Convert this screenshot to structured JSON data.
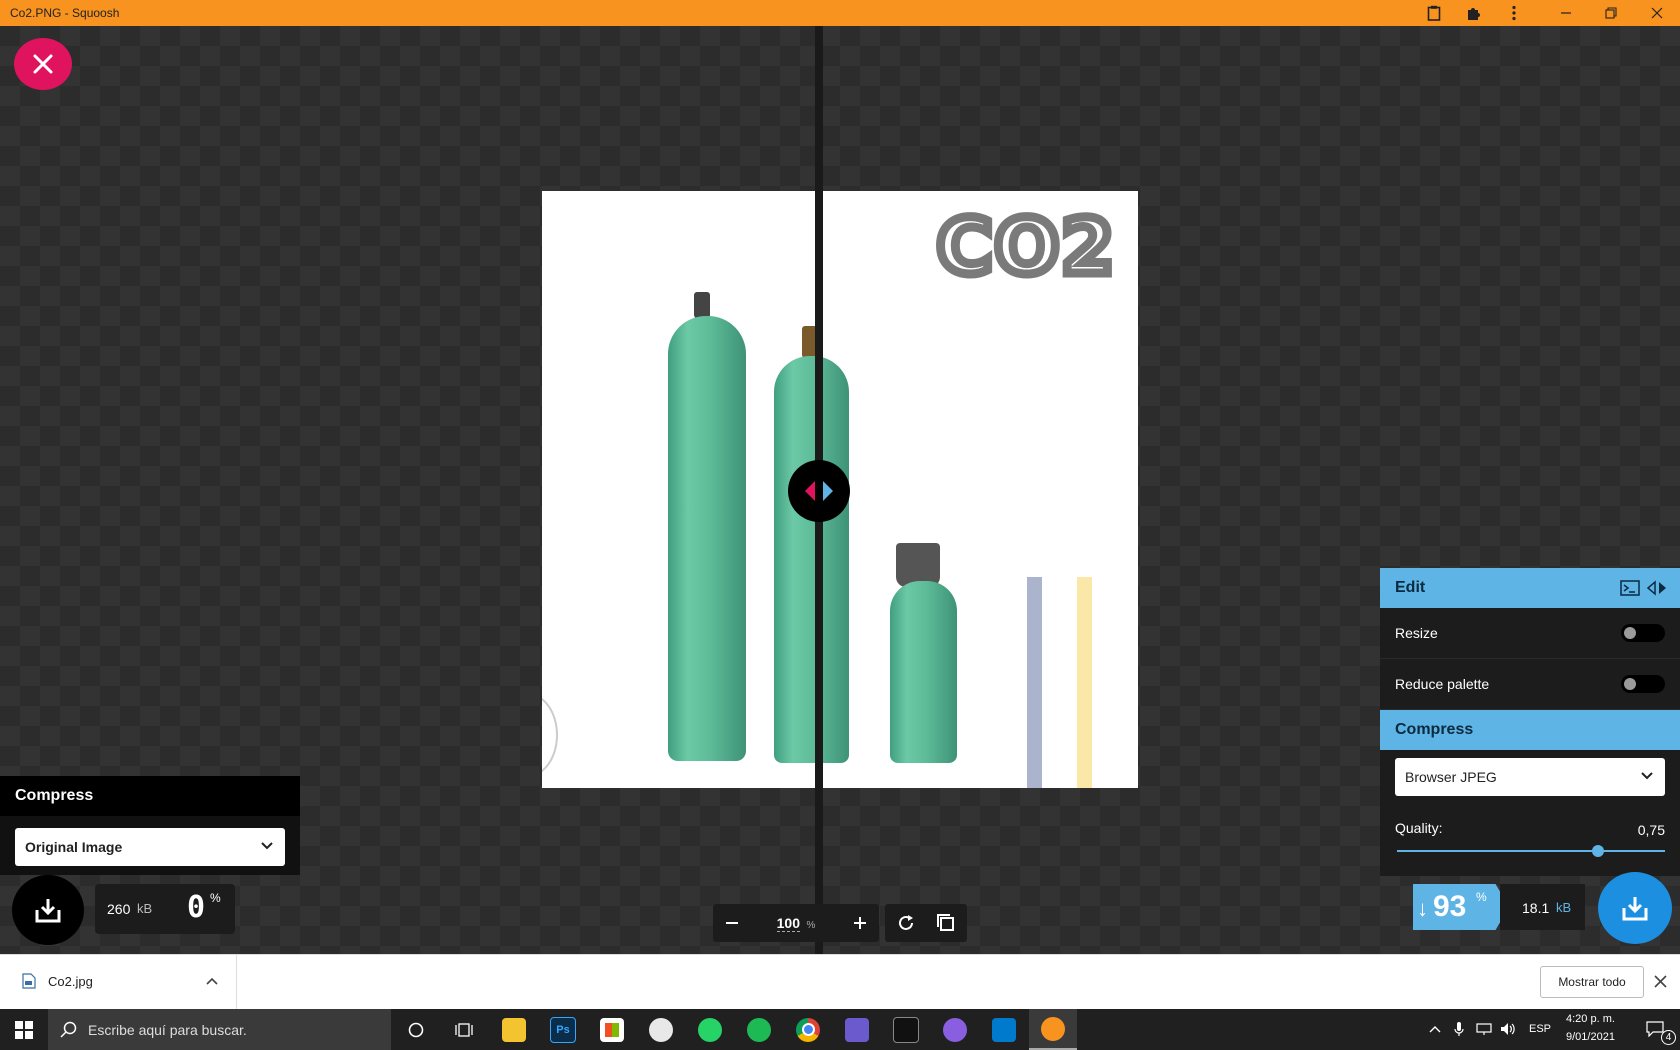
{
  "window": {
    "title": "Co2.PNG - Squoosh"
  },
  "image": {
    "label": "CO2"
  },
  "left_panel": {
    "heading": "Compress",
    "select_value": "Original Image",
    "size_value": "260",
    "size_unit": "kB",
    "percent_value": "0",
    "percent_unit": "%"
  },
  "right_panel": {
    "edit_heading": "Edit",
    "resize_label": "Resize",
    "resize_on": false,
    "reduce_palette_label": "Reduce palette",
    "reduce_palette_on": false,
    "compress_heading": "Compress",
    "codec_value": "Browser JPEG",
    "quality_label": "Quality:",
    "quality_value": "0,75",
    "quality_fraction": 0.75,
    "percent_arrow": "↓",
    "percent_value": "93",
    "percent_unit": "%",
    "size_value": "18.1",
    "size_unit": "kB"
  },
  "zoom": {
    "value": "100",
    "unit": "%"
  },
  "downloads": {
    "file_name": "Co2.jpg",
    "show_all_label": "Mostrar todo"
  },
  "taskbar": {
    "search_placeholder": "Escribe aquí para buscar.",
    "language": "ESP",
    "time": "4:20 p. m.",
    "date": "9/01/2021",
    "notification_count": "4"
  },
  "colors": {
    "title_bar": "#f7931e",
    "close_button": "#e0135f",
    "accent_blue": "#5fb4e6",
    "download_blue": "#1d8fe0"
  }
}
